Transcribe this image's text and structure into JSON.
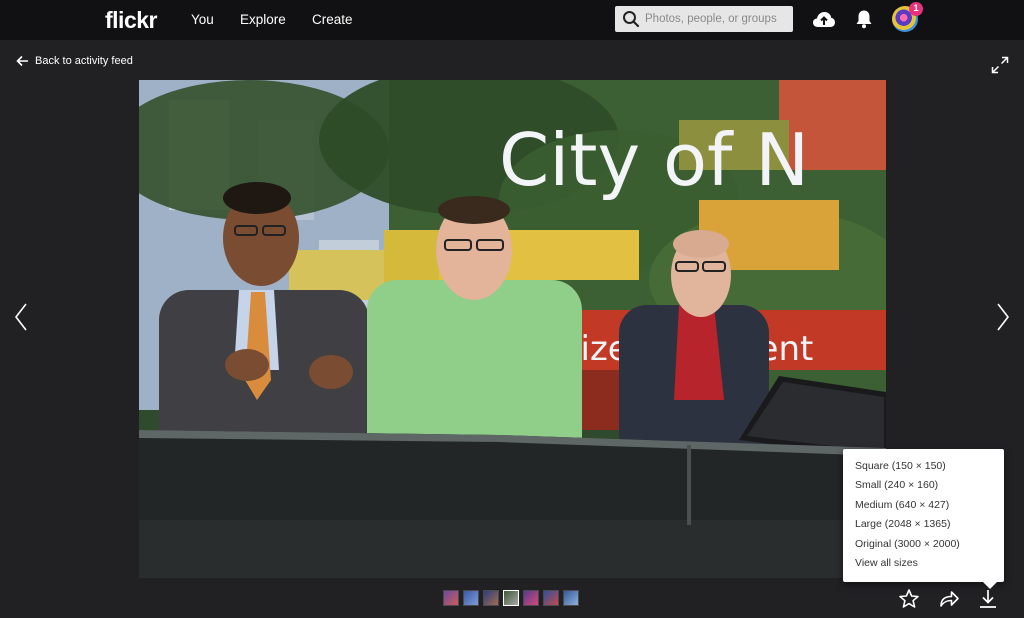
{
  "nav": {
    "logo": "flickr",
    "links": [
      "You",
      "Explore",
      "Create"
    ],
    "search_placeholder": "Photos, people, or groups",
    "notification_count": "1"
  },
  "subheader": {
    "back_label": "Back to activity feed"
  },
  "photo": {
    "sign_text": "City of N",
    "sign_subtext": "Citizen   agement"
  },
  "download_menu": {
    "items": [
      "Square (150 × 150)",
      "Small (240 × 160)",
      "Medium (640 × 427)",
      "Large (2048 × 1365)",
      "Original (3000 × 2000)",
      "View all sizes"
    ]
  },
  "filmstrip": {
    "count": 7
  },
  "colors": {
    "background": "#212124",
    "topbar": "#111113",
    "badge": "#e8327c"
  }
}
